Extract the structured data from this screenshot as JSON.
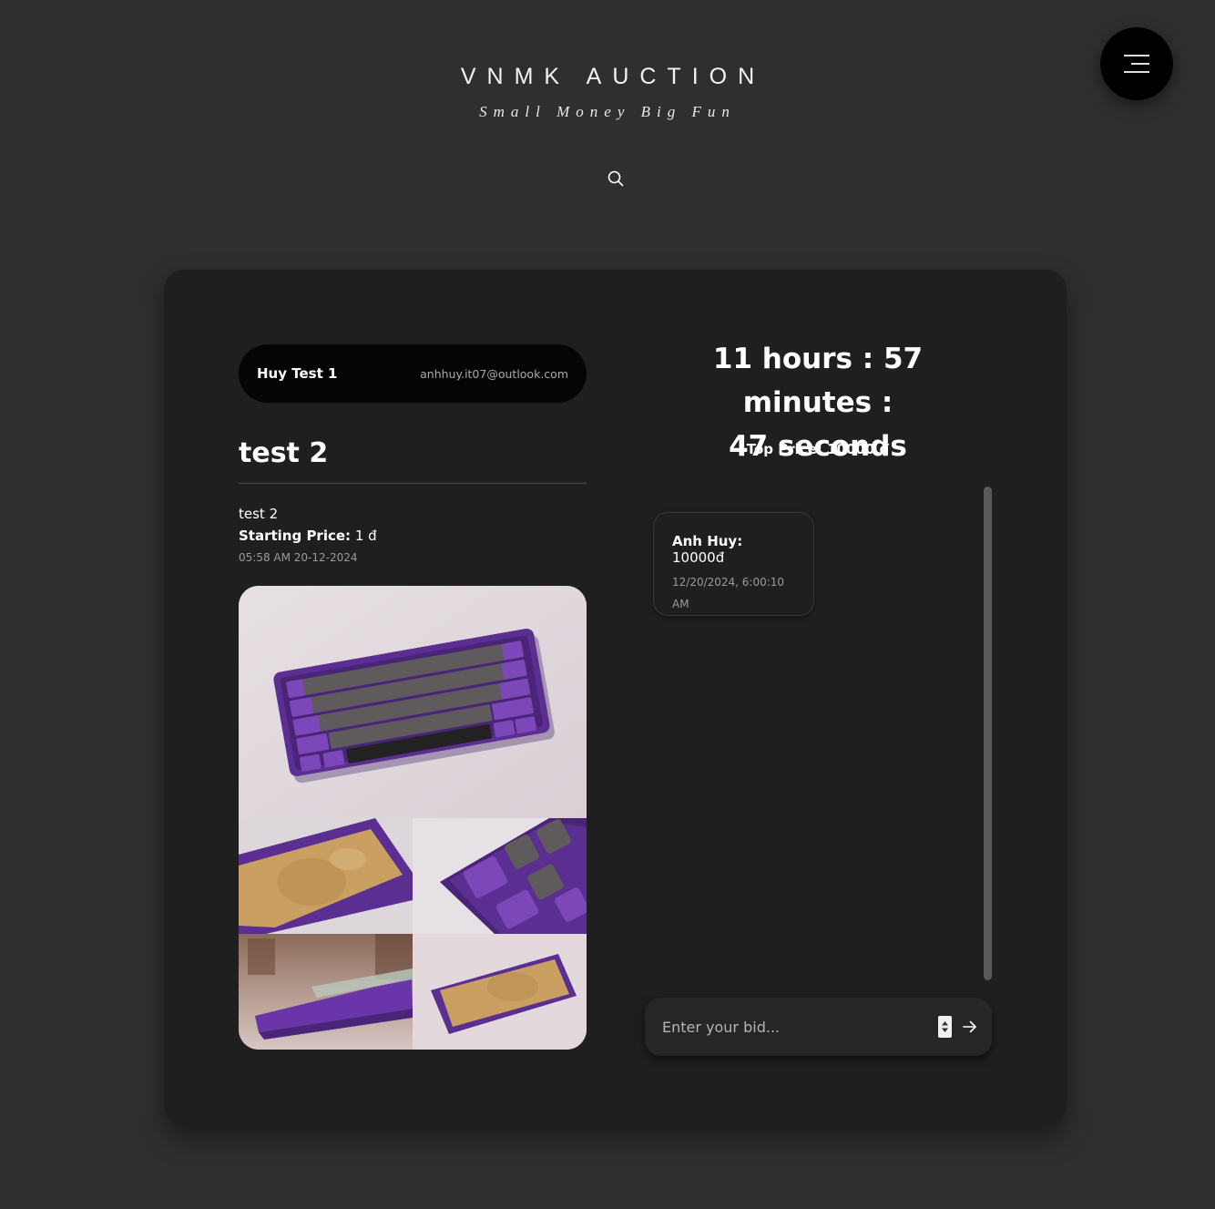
{
  "header": {
    "brand_title": "VNMK AUCTION",
    "brand_tagline": "Small Money Big Fun",
    "search_icon": "search-icon",
    "menu_icon": "hamburger-menu-icon"
  },
  "seller": {
    "name": "Huy Test 1",
    "email": "anhhuy.it07@outlook.com"
  },
  "item": {
    "title": "test 2",
    "description": "test 2",
    "starting_price_label": "Starting Price:",
    "starting_price_value": "1 đ",
    "created_at": "05:58 AM 20-12-2024",
    "images": [
      "keyboard-top-view-photo",
      "brass-plate-photo",
      "keyboard-esc-closeup-photo",
      "keyboard-side-blur-photo",
      "keyboard-back-plate-photo"
    ]
  },
  "auction": {
    "countdown_line1": "11 hours : 57 minutes :",
    "countdown_line2": "47 seconds",
    "top_price": "Top Price: 10000 đ"
  },
  "bids": [
    {
      "bidder": "Anh Huy:",
      "amount": "10000đ",
      "time_line1": "12/20/2024, 6:00:10",
      "time_line2": "AM"
    }
  ],
  "bid_form": {
    "placeholder": "Enter your bid...",
    "submit_icon": "arrow-right-icon"
  },
  "colors": {
    "page_bg": "#2f2f2f",
    "card_bg": "#1f1f1f",
    "pill_bg": "#050505",
    "accent_purple": "#5b2e91"
  }
}
